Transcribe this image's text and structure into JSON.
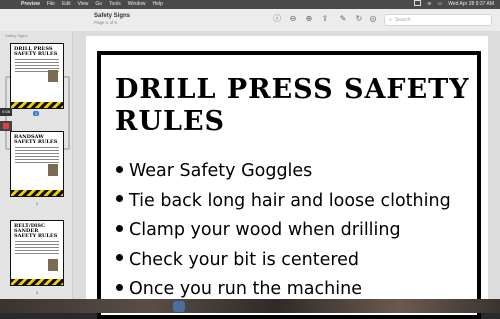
{
  "menubar": {
    "app_name": "Preview",
    "items": [
      "File",
      "Edit",
      "View",
      "Go",
      "Tools",
      "Window",
      "Help"
    ],
    "clock": "Wed Apr 28  9:37 AM"
  },
  "window": {
    "title": "Safety Signs",
    "subtitle": "Page 1 of 6",
    "search_placeholder": "Search"
  },
  "sidebar": {
    "label": "Safety Signs",
    "thumbnails": [
      {
        "title": "DRILL PRESS SAFETY RULES",
        "page": "1"
      },
      {
        "title": "BANDSAW SAFETY RULES",
        "page": "2"
      },
      {
        "title": "BELT/DISC SANDER SAFETY RULES",
        "page": "3"
      }
    ]
  },
  "badges": {
    "time": "0:08"
  },
  "document": {
    "title": "DRILL PRESS SAFETY RULES",
    "rules": [
      "Wear Safety Goggles",
      "Tie back long hair and loose clothing",
      "Clamp your wood when drilling",
      "Check your bit is centered",
      "Once you run the machine"
    ]
  },
  "icons": {
    "apple": "apple-icon",
    "wifi": "wifi-icon",
    "battery": "battery-icon",
    "search": "search-icon",
    "zoom_out": "zoom-out-icon",
    "zoom_in": "zoom-in-icon",
    "share": "share-icon",
    "markup": "markup-pen-icon",
    "rotate": "rotate-icon",
    "annotate": "annotate-icon"
  }
}
